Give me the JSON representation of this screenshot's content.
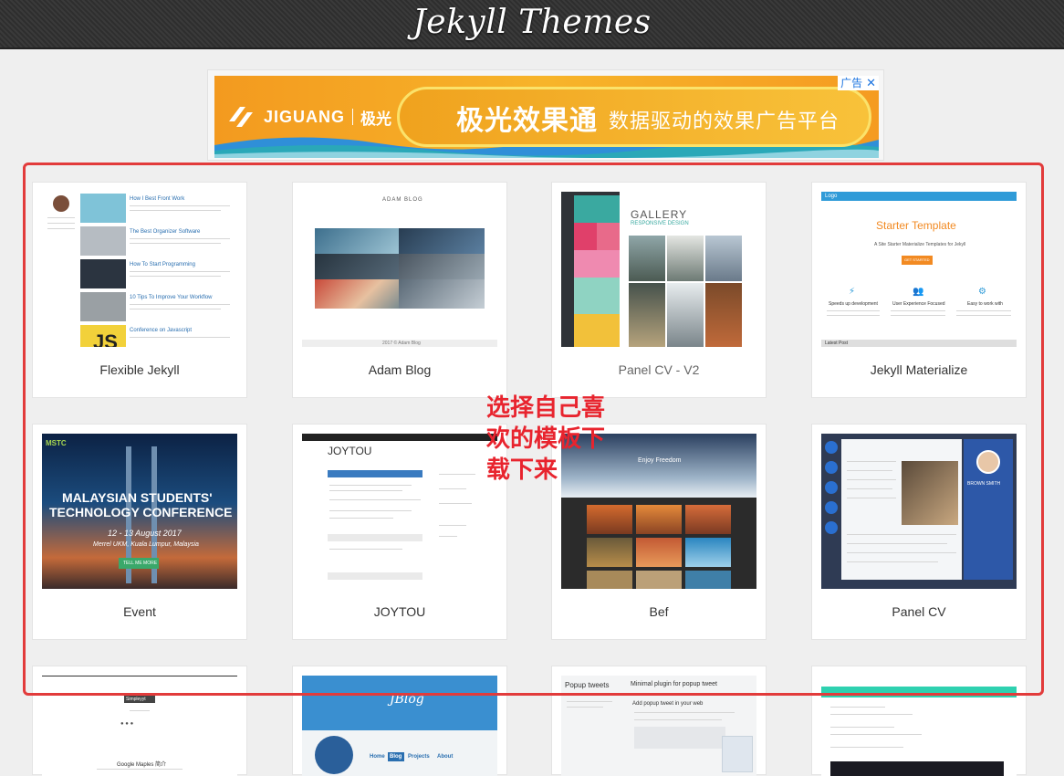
{
  "header": {
    "title": "Jekyll Themes"
  },
  "ad": {
    "brand": "JIGUANG",
    "brand_cn": "极光",
    "slogan_main": "极光效果通",
    "slogan_sub": "数据驱动的效果广告平台",
    "badge": "广告",
    "close": "✕"
  },
  "annotation": {
    "text": "选择自己喜欢的模板下载下来"
  },
  "themes": [
    {
      "title": "Flexible Jekyll"
    },
    {
      "title": "Adam Blog"
    },
    {
      "title": "Panel CV - V2"
    },
    {
      "title": "Jekyll Materialize"
    },
    {
      "title": "Event"
    },
    {
      "title": "JOYTOU"
    },
    {
      "title": "Bef"
    },
    {
      "title": "Panel CV"
    }
  ],
  "thumbs": {
    "flexible": {
      "posts": [
        "How I Best Front Work",
        "The Best Organizer Software",
        "How To Start Programming",
        "10 Tips To Improve Your Workflow",
        "Conference on Javascript"
      ],
      "js": "JS"
    },
    "adam": {
      "brand": "ADAM BLOG",
      "footer": "2017 © Adam Blog"
    },
    "panelv2": {
      "title": "GALLERY",
      "subtitle": "RESPONSIVE DESIGN"
    },
    "materialize": {
      "logo": "Logo",
      "heading": "Starter Template",
      "sub": "A Site Starter Materialize Templates for Jekyll",
      "button": "GET STARTED",
      "features": [
        "Speeds up development",
        "User Experience Focused",
        "Easy to work with"
      ],
      "latest": "Latest Post"
    },
    "event": {
      "logo": "MSTC",
      "headline1": "MALAYSIAN STUDENTS'",
      "headline2": "TECHNOLOGY CONFERENCE",
      "date": "12 - 13 August 2017",
      "venue": "Merrel UKM, Kuala Lumpur, Malaysia",
      "button": "TELL ME MORE"
    },
    "joytou": {
      "brand": "JOYTOU"
    },
    "bef": {
      "tagline": "Enjoy Freedom"
    },
    "panelcv": {
      "name": "BROWN SMITH"
    }
  },
  "row3": {
    "simple": {
      "badge": "Simpleyyt",
      "footer": "Google Maples 简介"
    },
    "jblog": {
      "brand": "JBlog",
      "nav": [
        "Home",
        "Blog",
        "Projects",
        "About"
      ]
    },
    "popup": {
      "title": "Popup tweets",
      "subtitle": "Minimal plugin for popup tweet",
      "heading": "Add popup tweet in your web"
    }
  }
}
